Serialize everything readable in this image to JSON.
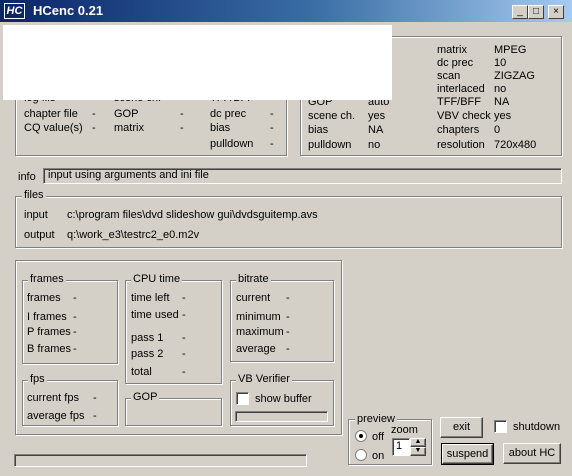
{
  "window": {
    "title": "HCenc 0.21",
    "icon_text": "HC",
    "min_symbol": "_",
    "max_symbol": "□",
    "close_symbol": "×"
  },
  "settings_left": {
    "rows": [
      {
        "label": "log file",
        "value": "-",
        "label2": "scene ch.",
        "value2": "-",
        "label3": "TFF/BFF",
        "value3": "-"
      },
      {
        "label": "chapter file",
        "value": "-",
        "label2": "GOP",
        "value2": "-",
        "label3": "dc prec",
        "value3": "-"
      },
      {
        "label": "CQ value(s)",
        "value": "-",
        "label2": "matrix",
        "value2": "-",
        "label3": "bias",
        "value3": "-"
      },
      {
        "label": "",
        "value": "",
        "label2": "",
        "value2": "",
        "label3": "pulldown",
        "value3": "-"
      }
    ]
  },
  "settings_right": {
    "col1_partial": "al",
    "col1": [
      {
        "label": "GOP",
        "value": "auto"
      },
      {
        "label": "scene ch.",
        "value": "yes"
      },
      {
        "label": "bias",
        "value": "NA"
      },
      {
        "label": "pulldown",
        "value": "no"
      }
    ],
    "col2": [
      {
        "label": "matrix",
        "value": "MPEG"
      },
      {
        "label": "dc prec",
        "value": "10"
      },
      {
        "label": "scan",
        "value": "ZIGZAG"
      },
      {
        "label": "interlaced",
        "value": "no"
      },
      {
        "label": "TFF/BFF",
        "value": "NA"
      },
      {
        "label": "VBV check",
        "value": "yes"
      },
      {
        "label": "chapters",
        "value": "0"
      },
      {
        "label": "resolution",
        "value": "720x480"
      }
    ]
  },
  "info": {
    "label": "info",
    "text": "input using arguments and ini file"
  },
  "files": {
    "title": "files",
    "input_label": "input",
    "input_value": "c:\\program files\\dvd slideshow gui\\dvdsguitemp.avs",
    "output_label": "output",
    "output_value": "q:\\work_e3\\testrc2_e0.m2v"
  },
  "frames": {
    "title": "frames",
    "rows": [
      {
        "label": "frames",
        "value": "-"
      },
      {
        "label": "I frames",
        "value": "-"
      },
      {
        "label": "P frames",
        "value": "-"
      },
      {
        "label": "B frames",
        "value": "-"
      }
    ]
  },
  "fps": {
    "title": "fps",
    "rows": [
      {
        "label": "current fps",
        "value": "-"
      },
      {
        "label": "average fps",
        "value": "-"
      }
    ]
  },
  "cpu": {
    "title": "CPU time",
    "rows": [
      {
        "label": "time left",
        "value": "-"
      },
      {
        "label": "time used",
        "value": "-"
      },
      {
        "label": "pass 1",
        "value": "-"
      },
      {
        "label": "pass 2",
        "value": "-"
      },
      {
        "label": "total",
        "value": "-"
      }
    ]
  },
  "gop": {
    "title": "GOP"
  },
  "bitrate": {
    "title": "bitrate",
    "rows": [
      {
        "label": "current",
        "value": "-"
      },
      {
        "label": "minimum",
        "value": "-"
      },
      {
        "label": "maximum",
        "value": "-"
      },
      {
        "label": "average",
        "value": "-"
      }
    ]
  },
  "vbv": {
    "title": "VB Verifier",
    "show_buffer_label": "show buffer"
  },
  "preview": {
    "title": "preview",
    "off_label": "off",
    "on_label": "on",
    "zoom_label": "zoom",
    "zoom_value": "1",
    "selected": "off"
  },
  "buttons": {
    "exit": "exit",
    "shutdown": "shutdown",
    "suspend": "suspend",
    "about": "about HC"
  }
}
